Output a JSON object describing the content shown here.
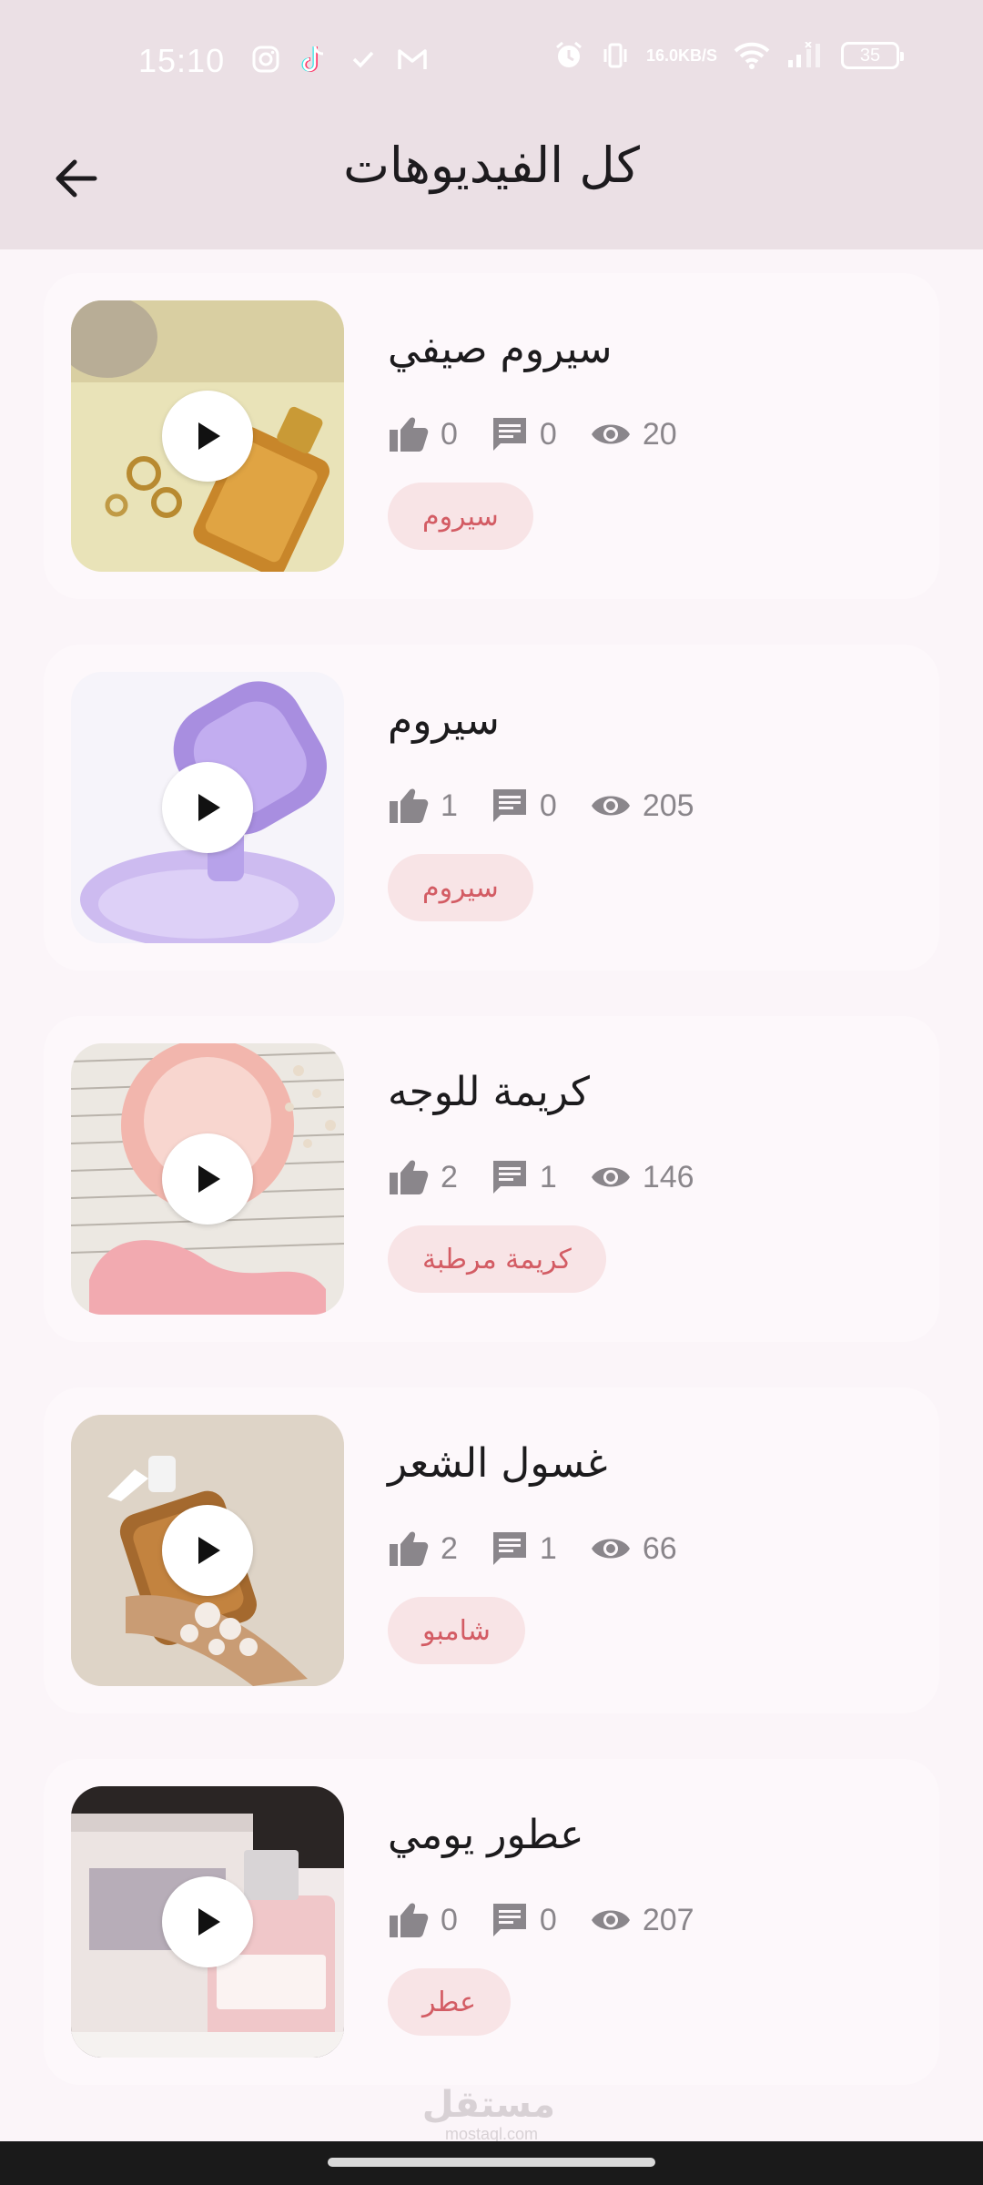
{
  "status_bar": {
    "time": "15:10",
    "net_speed_value": "16.0",
    "net_speed_unit": "KB/S",
    "battery": "35",
    "icons_left": [
      "instagram-icon",
      "tiktok-icon",
      "check-icon",
      "gmail-icon"
    ],
    "icons_right": [
      "alarm-icon",
      "vibrate-icon",
      "wifi-icon",
      "signal-icon"
    ]
  },
  "app_bar": {
    "title": "كل الفيديوهات",
    "back_icon": "arrow-back-icon"
  },
  "videos": [
    {
      "title": "سيروم صيفي",
      "likes": "0",
      "comments": "0",
      "views": "20",
      "tag": "سيروم"
    },
    {
      "title": "سيروم",
      "likes": "1",
      "comments": "0",
      "views": "205",
      "tag": "سيروم"
    },
    {
      "title": "كريمة للوجه",
      "likes": "2",
      "comments": "1",
      "views": "146",
      "tag": "كريمة مرطبة"
    },
    {
      "title": "غسول الشعر",
      "likes": "2",
      "comments": "1",
      "views": "66",
      "tag": "شامبو"
    },
    {
      "title": "عطور يومي",
      "likes": "0",
      "comments": "0",
      "views": "207",
      "tag": "عطر"
    }
  ],
  "watermark": {
    "arabic": "مستقل",
    "latin": "mostaql.com"
  },
  "colors": {
    "header_bg": "#ebe0e5",
    "page_bg": "#fbf5f9",
    "card_bg": "#fdf8fb",
    "tag_bg": "#f8e4e6",
    "tag_text": "#d35c64",
    "stat_gray": "#8a868b"
  }
}
